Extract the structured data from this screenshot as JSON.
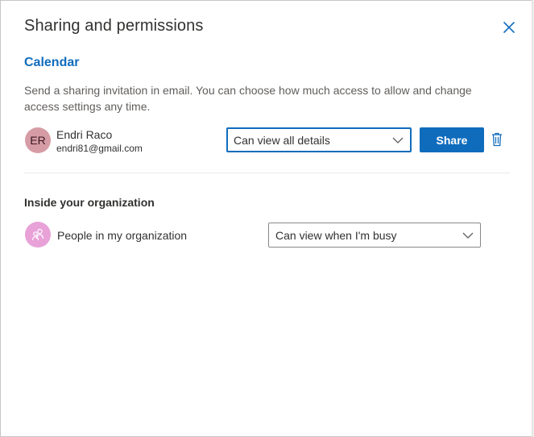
{
  "dialog": {
    "title": "Sharing and permissions",
    "close_icon": "close-icon"
  },
  "calendar": {
    "name": "Calendar",
    "description": "Send a sharing invitation in email. You can choose how much access to allow and change access settings any time."
  },
  "invitee": {
    "initials": "ER",
    "name": "Endri Raco",
    "email": "endri81@gmail.com",
    "permission": "Can view all details",
    "share_label": "Share",
    "delete_icon": "trash-icon"
  },
  "organization": {
    "section_title": "Inside your organization",
    "name": "People in my organization",
    "permission": "Can view when I'm busy",
    "icon": "people-icon"
  },
  "colors": {
    "accent": "#0f6cbd",
    "avatar_er": "#d69ca5",
    "avatar_org": "#e8a2d8"
  }
}
